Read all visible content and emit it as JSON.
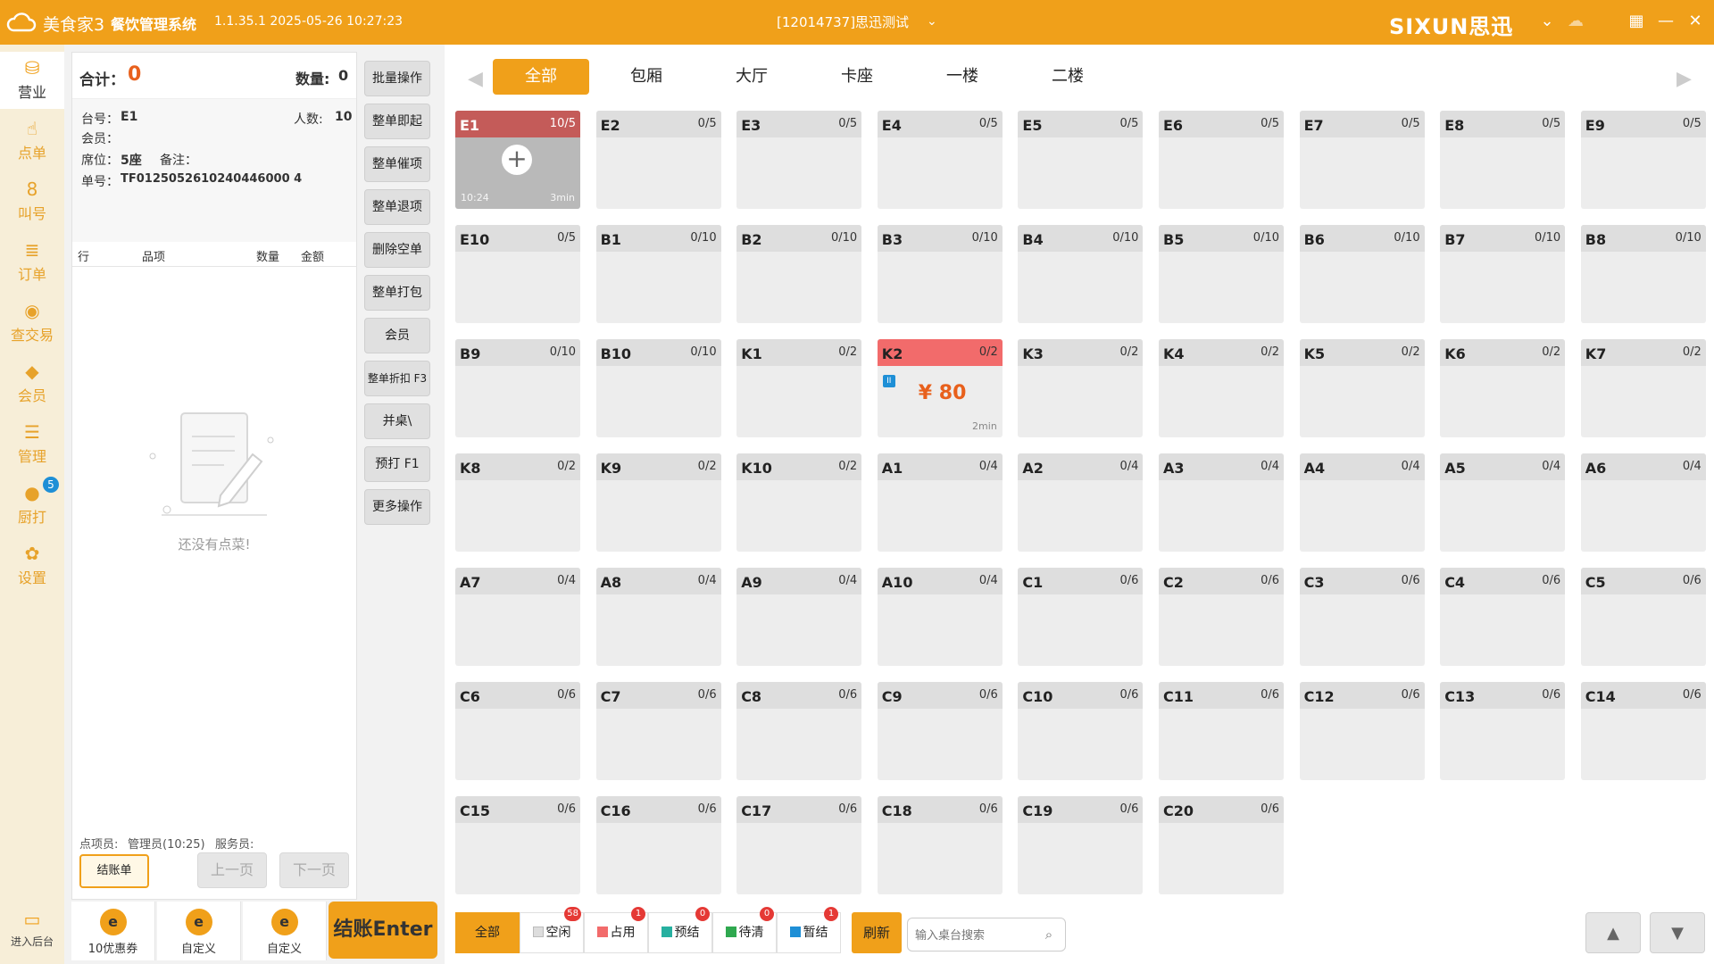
{
  "titlebar": {
    "brand": "美食家3",
    "system_name": "餐饮管理系统",
    "version": "1.1.35.1 2025-05-26 10:27:23",
    "account": "[12014737]思迅测试",
    "vendor_logo": "SIXUN思迅",
    "icons": [
      "cloud-logo-icon",
      "chevron-down-icon",
      "cloud-sync-icon",
      "qr-code-icon",
      "minimize-icon",
      "close-icon"
    ]
  },
  "leftnav": {
    "items": [
      {
        "label": "营业",
        "icon": "business-icon",
        "active": true
      },
      {
        "label": "点单",
        "icon": "order-icon"
      },
      {
        "label": "叫号",
        "icon": "call-number-icon"
      },
      {
        "label": "订单",
        "icon": "orders-icon"
      },
      {
        "label": "查交易",
        "icon": "transaction-icon"
      },
      {
        "label": "会员",
        "icon": "member-icon"
      },
      {
        "label": "管理",
        "icon": "manage-icon"
      },
      {
        "label": "厨打",
        "icon": "kitchen-print-icon",
        "badge": "5"
      },
      {
        "label": "设置",
        "icon": "settings-icon"
      }
    ],
    "backend_label": "进入后台"
  },
  "order_panel": {
    "total_label": "合计：",
    "total_value": "0",
    "qty_label": "数量:",
    "qty_value": "0",
    "table_label": "台号：",
    "table_value": "E1",
    "people_label": "人数:",
    "people_value": "10",
    "member_label": "会员：",
    "seat_label": "席位：",
    "seat_value": "5座",
    "remark_label": "备注：",
    "bill_label": "单号：",
    "bill_value": "TF0125052610240446000 4",
    "columns": [
      "行",
      "品项",
      "数量",
      "金额"
    ],
    "empty_text": "还没有点菜!",
    "orderer_label": "点项员:",
    "orderer_value": "管理员(10:25)",
    "server_label": "服务员:",
    "bill_button": "结账单",
    "prev_page": "上一页",
    "next_page": "下一页"
  },
  "bottom_left": {
    "buttons": [
      "10优惠券",
      "自定义",
      "自定义"
    ],
    "checkout": "结账Enter"
  },
  "actions": [
    "批量操作",
    "整单即起",
    "整单催项",
    "整单退项",
    "删除空单",
    "整单打包",
    "会员",
    "整单折扣 F3",
    "并桌\\",
    "预打 F1",
    "更多操作"
  ],
  "area_tabs": [
    "全部",
    "包厢",
    "大厅",
    "卡座",
    "一楼",
    "二楼"
  ],
  "tables": [
    {
      "name": "E1",
      "cap": "10/5",
      "state": "opened",
      "time": "10:24",
      "duration": "3min"
    },
    {
      "name": "E2",
      "cap": "0/5"
    },
    {
      "name": "E3",
      "cap": "0/5"
    },
    {
      "name": "E4",
      "cap": "0/5"
    },
    {
      "name": "E5",
      "cap": "0/5"
    },
    {
      "name": "E6",
      "cap": "0/5"
    },
    {
      "name": "E7",
      "cap": "0/5"
    },
    {
      "name": "E8",
      "cap": "0/5"
    },
    {
      "name": "E9",
      "cap": "0/5"
    },
    {
      "name": "E10",
      "cap": "0/5"
    },
    {
      "name": "B1",
      "cap": "0/10"
    },
    {
      "name": "B2",
      "cap": "0/10"
    },
    {
      "name": "B3",
      "cap": "0/10"
    },
    {
      "name": "B4",
      "cap": "0/10"
    },
    {
      "name": "B5",
      "cap": "0/10"
    },
    {
      "name": "B6",
      "cap": "0/10"
    },
    {
      "name": "B7",
      "cap": "0/10"
    },
    {
      "name": "B8",
      "cap": "0/10"
    },
    {
      "name": "B9",
      "cap": "0/10"
    },
    {
      "name": "B10",
      "cap": "0/10"
    },
    {
      "name": "K1",
      "cap": "0/2"
    },
    {
      "name": "K2",
      "cap": "0/2",
      "state": "occupied",
      "amount": "¥ 80",
      "duration": "2min",
      "tag": "II"
    },
    {
      "name": "K3",
      "cap": "0/2"
    },
    {
      "name": "K4",
      "cap": "0/2"
    },
    {
      "name": "K5",
      "cap": "0/2"
    },
    {
      "name": "K6",
      "cap": "0/2"
    },
    {
      "name": "K7",
      "cap": "0/2"
    },
    {
      "name": "K8",
      "cap": "0/2"
    },
    {
      "name": "K9",
      "cap": "0/2"
    },
    {
      "name": "K10",
      "cap": "0/2"
    },
    {
      "name": "A1",
      "cap": "0/4"
    },
    {
      "name": "A2",
      "cap": "0/4"
    },
    {
      "name": "A3",
      "cap": "0/4"
    },
    {
      "name": "A4",
      "cap": "0/4"
    },
    {
      "name": "A5",
      "cap": "0/4"
    },
    {
      "name": "A6",
      "cap": "0/4"
    },
    {
      "name": "A7",
      "cap": "0/4"
    },
    {
      "name": "A8",
      "cap": "0/4"
    },
    {
      "name": "A9",
      "cap": "0/4"
    },
    {
      "name": "A10",
      "cap": "0/4"
    },
    {
      "name": "C1",
      "cap": "0/6"
    },
    {
      "name": "C2",
      "cap": "0/6"
    },
    {
      "name": "C3",
      "cap": "0/6"
    },
    {
      "name": "C4",
      "cap": "0/6"
    },
    {
      "name": "C5",
      "cap": "0/6"
    },
    {
      "name": "C6",
      "cap": "0/6"
    },
    {
      "name": "C7",
      "cap": "0/6"
    },
    {
      "name": "C8",
      "cap": "0/6"
    },
    {
      "name": "C9",
      "cap": "0/6"
    },
    {
      "name": "C10",
      "cap": "0/6"
    },
    {
      "name": "C11",
      "cap": "0/6"
    },
    {
      "name": "C12",
      "cap": "0/6"
    },
    {
      "name": "C13",
      "cap": "0/6"
    },
    {
      "name": "C14",
      "cap": "0/6"
    },
    {
      "name": "C15",
      "cap": "0/6"
    },
    {
      "name": "C16",
      "cap": "0/6"
    },
    {
      "name": "C17",
      "cap": "0/6"
    },
    {
      "name": "C18",
      "cap": "0/6"
    },
    {
      "name": "C19",
      "cap": "0/6"
    },
    {
      "name": "C20",
      "cap": "0/6"
    }
  ],
  "filters": [
    {
      "label": "全部",
      "active": true
    },
    {
      "label": "空闲",
      "count": "58",
      "color": "#dddddd"
    },
    {
      "label": "占用",
      "count": "1",
      "color": "#f26b6b"
    },
    {
      "label": "预结",
      "count": "0",
      "color": "#27b0a0"
    },
    {
      "label": "待清",
      "count": "0",
      "color": "#2fa84f"
    },
    {
      "label": "暂结",
      "count": "1",
      "color": "#1e8fd6"
    }
  ],
  "refresh_label": "刷新",
  "search_placeholder": "输入桌台搜索",
  "colors": {
    "accent": "#f0a01a",
    "occupied": "#f26b6b",
    "opened": "#c45b59",
    "amount": "#e8601c"
  }
}
